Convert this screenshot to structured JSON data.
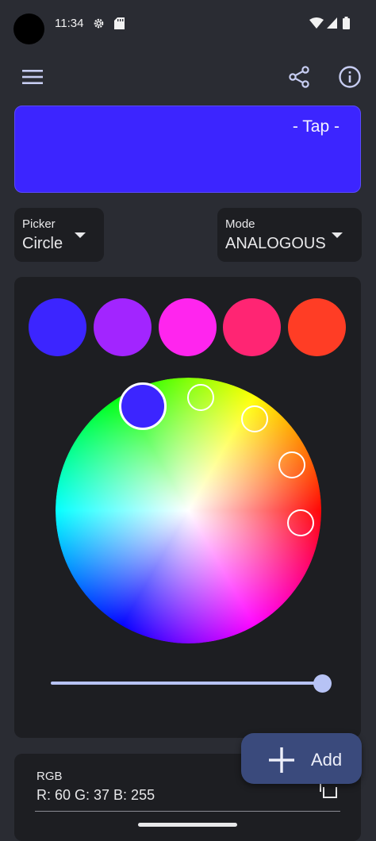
{
  "status_bar": {
    "time": "11:34"
  },
  "preview": {
    "label": "- Tap -",
    "color": "#3c25ff"
  },
  "picker_dropdown": {
    "label": "Picker",
    "value": "Circle"
  },
  "mode_dropdown": {
    "label": "Mode",
    "value": "ANALOGOUS"
  },
  "swatches": [
    "#3c25ff",
    "#a225ff",
    "#ff25ee",
    "#ff2573",
    "#ff3d25"
  ],
  "brightness_slider": {
    "value": 1.0
  },
  "rgb": {
    "label": "RGB",
    "value": "R: 60 G: 37 B: 255"
  },
  "fab": {
    "label": "Add"
  },
  "colors": {
    "accent": "#b7c3f5",
    "fab": "#3a4a7c",
    "surface": "#1d1e22",
    "background": "#2a2c33"
  }
}
